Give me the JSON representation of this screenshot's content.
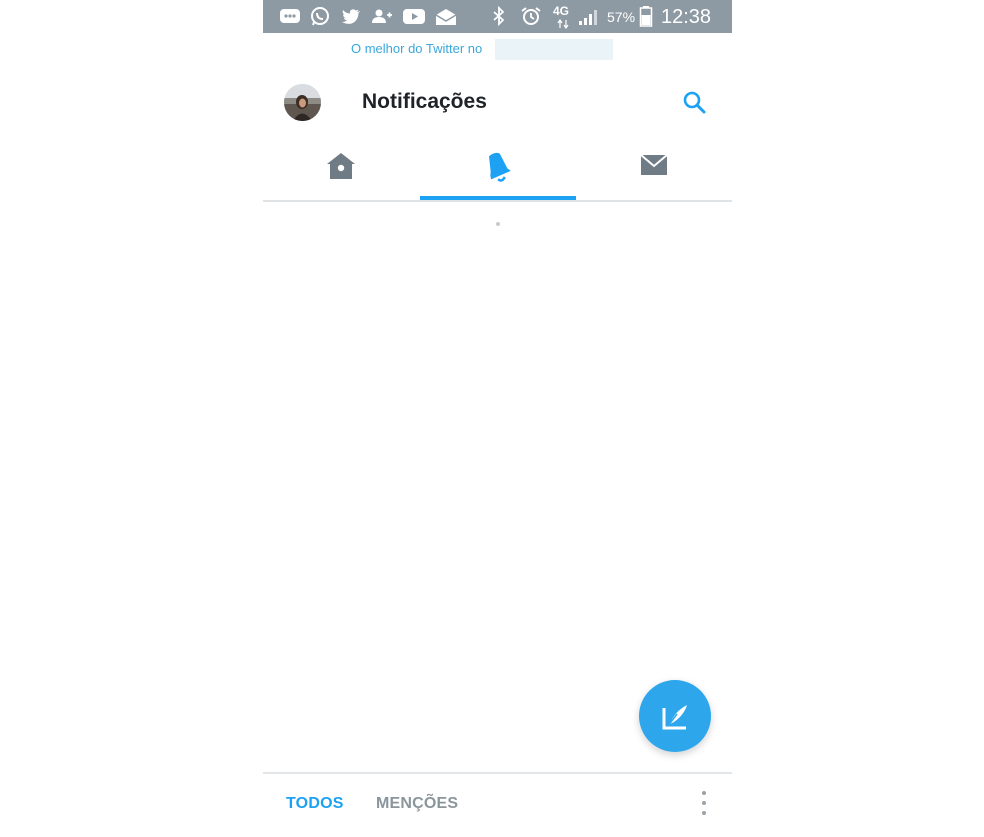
{
  "status_bar": {
    "icons": [
      "message-icon",
      "whatsapp-icon",
      "twitter-bird-icon",
      "add-contact-icon",
      "youtube-icon",
      "email-icon",
      "bluetooth-icon",
      "alarm-icon",
      "network-4g-icon",
      "signal-icon",
      "battery-icon"
    ],
    "network": "4G",
    "battery": "57%",
    "time": "12:38"
  },
  "promo": {
    "text": "O melhor do Twitter no"
  },
  "header": {
    "title": "Notificações",
    "search_icon": "search-icon",
    "avatar_icon": "avatar"
  },
  "tabs": [
    {
      "name": "home",
      "icon": "home-icon",
      "active": false
    },
    {
      "name": "notifications",
      "icon": "bell-icon",
      "active": true
    },
    {
      "name": "messages",
      "icon": "envelope-icon",
      "active": false
    }
  ],
  "fab": {
    "icon": "compose-tweet-icon"
  },
  "filters": {
    "all": "TODOS",
    "mentions": "MENÇÕES",
    "more_icon": "more-vertical-icon"
  },
  "colors": {
    "accent": "#1da1f2",
    "fab": "#2ea6ec",
    "status_bar": "#8e9aa3",
    "inactive_icon": "#6f7c86",
    "inactive_text": "#8a959c"
  }
}
